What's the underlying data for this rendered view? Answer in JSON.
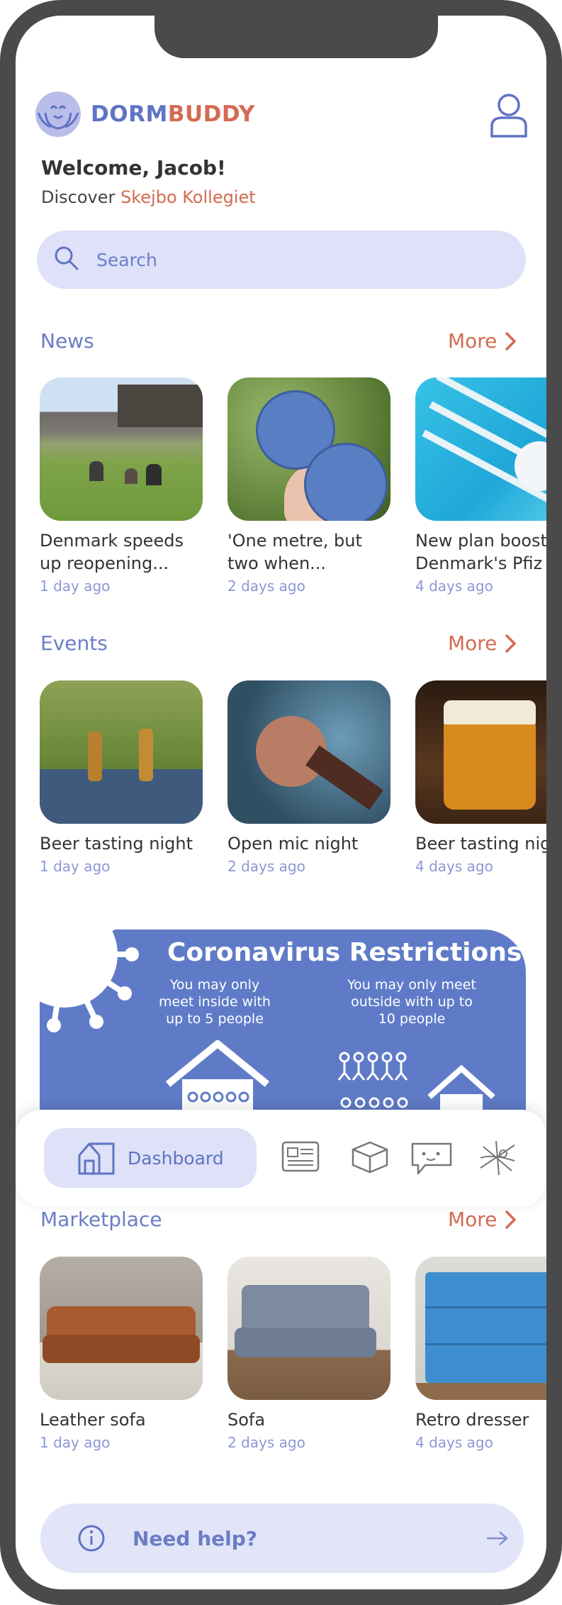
{
  "brand": {
    "part1": "DORM",
    "part2": "BUDDY"
  },
  "header": {
    "welcome": "Welcome, Jacob!",
    "discover_prefix": "Discover ",
    "dorm_name": "Skejbo Kollegiet"
  },
  "search": {
    "placeholder": "Search"
  },
  "news": {
    "title": "News",
    "more": "More",
    "items": [
      {
        "title": "Denmark speeds\nup reopening...",
        "time": "1 day ago"
      },
      {
        "title": "'One metre, but\ntwo when...",
        "time": "2 days ago"
      },
      {
        "title": "New plan boost\nDenmark's Pfiz",
        "time": "4 days ago"
      }
    ]
  },
  "events": {
    "title": "Events",
    "more": "More",
    "items": [
      {
        "title": "Beer tasting night",
        "time": "1 day ago"
      },
      {
        "title": "Open mic night",
        "time": "2 days ago"
      },
      {
        "title": "Beer tasting nig",
        "time": "4 days ago"
      }
    ]
  },
  "banner": {
    "title": "Coronavirus Restrictions",
    "rule_inside": "You may only\nmeet inside with\nup to 5 people",
    "rule_outside": "You may only meet\noutside with up to\n10 people"
  },
  "nav": {
    "dashboard": "Dashboard"
  },
  "marketplace": {
    "title": "Marketplace",
    "more": "More",
    "items": [
      {
        "title": "Leather sofa",
        "time": "1 day ago"
      },
      {
        "title": "Sofa",
        "time": "2 days ago"
      },
      {
        "title": "Retro dresser",
        "time": "4 days ago"
      }
    ]
  },
  "help": {
    "label": "Need help?"
  },
  "colors": {
    "accent": "#5f73c4",
    "brand_orange": "#d46a52",
    "light": "#dee1f7"
  }
}
